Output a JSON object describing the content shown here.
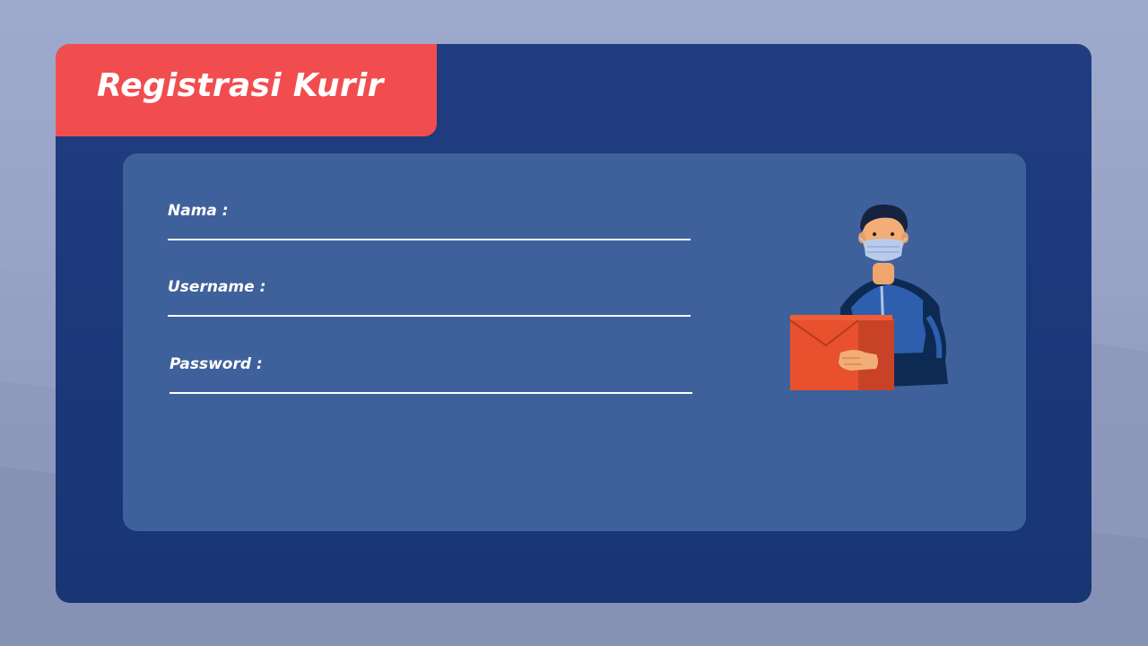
{
  "page": {
    "title": "Registrasi Kurir"
  },
  "form": {
    "fields": [
      {
        "label": "Nama :",
        "value": "",
        "placeholder": ""
      },
      {
        "label": "Username :",
        "value": "",
        "placeholder": ""
      },
      {
        "label": "Password :",
        "value": "",
        "placeholder": ""
      }
    ]
  },
  "illustration": {
    "icon": "courier-with-package-icon"
  },
  "colors": {
    "background": "#9eaacd",
    "card": "#1e3c7e",
    "title_tab": "#f14d4f",
    "panel": "#3e619b",
    "text": "#ffffff"
  }
}
